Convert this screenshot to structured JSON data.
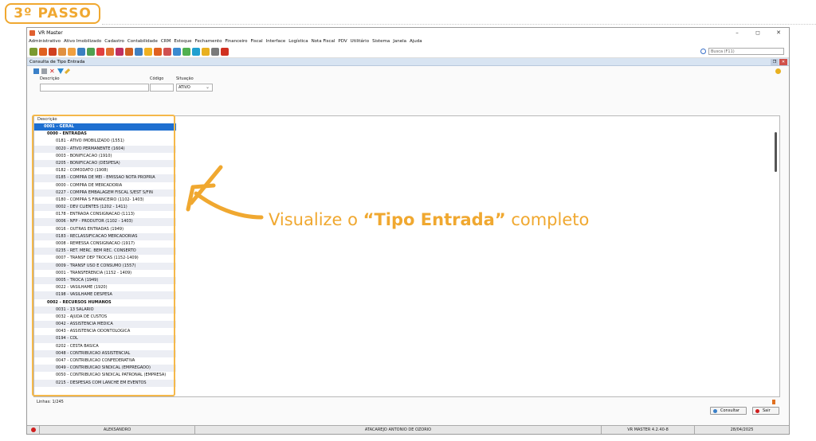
{
  "step_badge": "3º PASSO",
  "window": {
    "title": "VR Master",
    "controls": [
      "–",
      "◻",
      "✕"
    ]
  },
  "menu": [
    "Administrativo",
    "Ativo Imobilizado",
    "Cadastro",
    "Contabilidade",
    "CRM",
    "Estoque",
    "Fechamento",
    "Financeiro",
    "Fiscal",
    "Interface",
    "Logística",
    "Nota Fiscal",
    "PDV",
    "Utilitário",
    "Sistema",
    "Janela",
    "Ajuda"
  ],
  "toolbar": {
    "icon_colors": [
      "#7a9a30",
      "#e06020",
      "#d04020",
      "#e09040",
      "#f0a040",
      "#3a80c0",
      "#50a050",
      "#e04040",
      "#e07030",
      "#c03060",
      "#d06020",
      "#4080c0",
      "#f0b020",
      "#e06020",
      "#d05050",
      "#3a8ad0",
      "#50b050",
      "#20a0d0",
      "#e8b020",
      "#7a7a7a",
      "#d03020"
    ],
    "search_placeholder": "Busca (F11)"
  },
  "inner_window": {
    "title": "Consulta de Tipo Entrada"
  },
  "filters": {
    "descricao_label": "Descrição",
    "codigo_label": "Código",
    "situacao_label": "Situação",
    "situacao_value": "ATIVO"
  },
  "tree": {
    "header": "Descrição",
    "rows": [
      {
        "text": "0001 - GERAL",
        "kind": "sel"
      },
      {
        "text": "0000 - ENTRADAS",
        "kind": "grp"
      },
      {
        "text": "0181 - ATIVO IMOBILIZADO (1551)",
        "kind": "leaf"
      },
      {
        "text": "0020 - ATIVO PERMANENTE (1604)",
        "kind": "leaf"
      },
      {
        "text": "0003 - BONIFICACAO (1910)",
        "kind": "leaf"
      },
      {
        "text": "0205 - BONIFICACAO (DESPESA)",
        "kind": "leaf"
      },
      {
        "text": "0182 - COMODATO (1908)",
        "kind": "leaf"
      },
      {
        "text": "0185 - COMPRA DE MEI - EMISSAO NOTA PROPRIA",
        "kind": "leaf"
      },
      {
        "text": "0000 - COMPRA DE MERCADORIA",
        "kind": "leaf"
      },
      {
        "text": "0227 - COMPRA EMBALAGEM FISCAL S/EST S/FIN",
        "kind": "leaf"
      },
      {
        "text": "0180 - COMPRA S FINANCEIRO (1102- 1403)",
        "kind": "leaf"
      },
      {
        "text": "0002 - DEV CLIENTES (1202 - 1411)",
        "kind": "leaf"
      },
      {
        "text": "0178 - ENTRADA CONSIGNACAO (1113)",
        "kind": "leaf"
      },
      {
        "text": "0006 - NFP - PRODUTOR (1102 - 1403)",
        "kind": "leaf"
      },
      {
        "text": "0016 - OUTRAS ENTRADAS (1949)",
        "kind": "leaf"
      },
      {
        "text": "0183 - RECLASSIFICACAO MERCADORIAS",
        "kind": "leaf"
      },
      {
        "text": "0008 - REMESSA CONSIGNACAO (1917)",
        "kind": "leaf"
      },
      {
        "text": "0235 - RET. MERC. BEM REC. CONSERTO",
        "kind": "leaf"
      },
      {
        "text": "0007 - TRANSF DEP TROCAS (1152-1409)",
        "kind": "leaf"
      },
      {
        "text": "0009 - TRANSF USO E CONSUMO (1557)",
        "kind": "leaf"
      },
      {
        "text": "0001 - TRANSFERENCIA (1152 - 1409)",
        "kind": "leaf"
      },
      {
        "text": "0005 - TROCA (1949)",
        "kind": "leaf"
      },
      {
        "text": "0022 - VASILHAME (1920)",
        "kind": "leaf"
      },
      {
        "text": "0198 - VASILHAME DESPESA",
        "kind": "leaf"
      },
      {
        "text": "0002 - RECURSOS HUMANOS",
        "kind": "grp"
      },
      {
        "text": "0031 - 13 SALARIO",
        "kind": "leaf"
      },
      {
        "text": "0032 - AJUDA DE CUSTOS",
        "kind": "leaf"
      },
      {
        "text": "0042 - ASSISTENCIA MEDICA",
        "kind": "leaf"
      },
      {
        "text": "0043 - ASSISTENCIA ODONTOLOGICA",
        "kind": "leaf"
      },
      {
        "text": "0194 - CDL",
        "kind": "leaf"
      },
      {
        "text": "0202 - CESTA BASICA",
        "kind": "leaf"
      },
      {
        "text": "0048 - CONTRIBUICAO ASSISTENCIAL",
        "kind": "leaf"
      },
      {
        "text": "0047 - CONTRIBUICAO CONFEDERATIVA",
        "kind": "leaf"
      },
      {
        "text": "0049 - CONTRIBUICAO SINDICAL (EMPREGADO)",
        "kind": "leaf"
      },
      {
        "text": "0050 - CONTRIBUICAO SINDICAL PATRONAL (EMPRESA)",
        "kind": "leaf"
      },
      {
        "text": "0215 - DESPESAS COM LANCHE EM EVENTOS",
        "kind": "leaf"
      }
    ]
  },
  "annotation": {
    "prefix": "Visualize o ",
    "bold": "“Tipo Entrada”",
    "suffix": " completo",
    "color": "#f0a830"
  },
  "lines_count": "Linhas: 1/245",
  "buttons": {
    "consultar": "Consultar",
    "sair": "Sair"
  },
  "statusbar": {
    "user": "ALEKSANDRO",
    "company": "ATACAREJO ANTONIO DE OZORIO",
    "version": "VR MASTER 4.2.40-8",
    "date": "28/04/2025"
  }
}
